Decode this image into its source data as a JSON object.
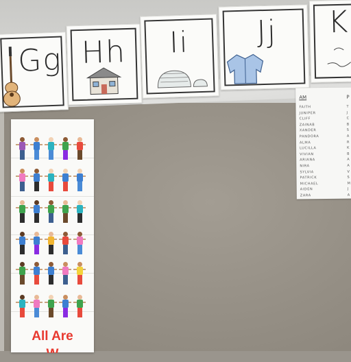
{
  "alphabet_cards": [
    {
      "letters": "Gg",
      "picture": "guitar-icon"
    },
    {
      "letters": "Hh",
      "picture": "house-icon"
    },
    {
      "letters": "Ii",
      "picture": "igloo-icon"
    },
    {
      "letters": "Jj",
      "picture": "jacket-icon"
    },
    {
      "letters": "K",
      "picture": "kite-icon"
    }
  ],
  "names_sheet": {
    "am_header": "AM",
    "pm_header": "P",
    "am_names": [
      "FAITH",
      "JUNIPER",
      "CLIFF",
      "ZAINAB",
      "XANDER",
      "PANDORA",
      "ALMA",
      "LUCILLA",
      "VIVIAN",
      "ARIANA",
      "NIRA",
      "SYLVIA",
      "PATRICK",
      "MICHAEL",
      "AIDEN",
      "ZARA"
    ],
    "pm_initials": [
      "T",
      "J",
      "C",
      "B",
      "S",
      "A",
      "R",
      "K",
      "B",
      "A",
      "A",
      "V",
      "S",
      "M",
      "J",
      "A"
    ]
  },
  "poster": {
    "slogan_line1": "All Are",
    "slogan_line2": "W"
  },
  "colors": {
    "poster_text": "#e8392f",
    "board": "#958f85",
    "wall": "#d3d3d0"
  }
}
